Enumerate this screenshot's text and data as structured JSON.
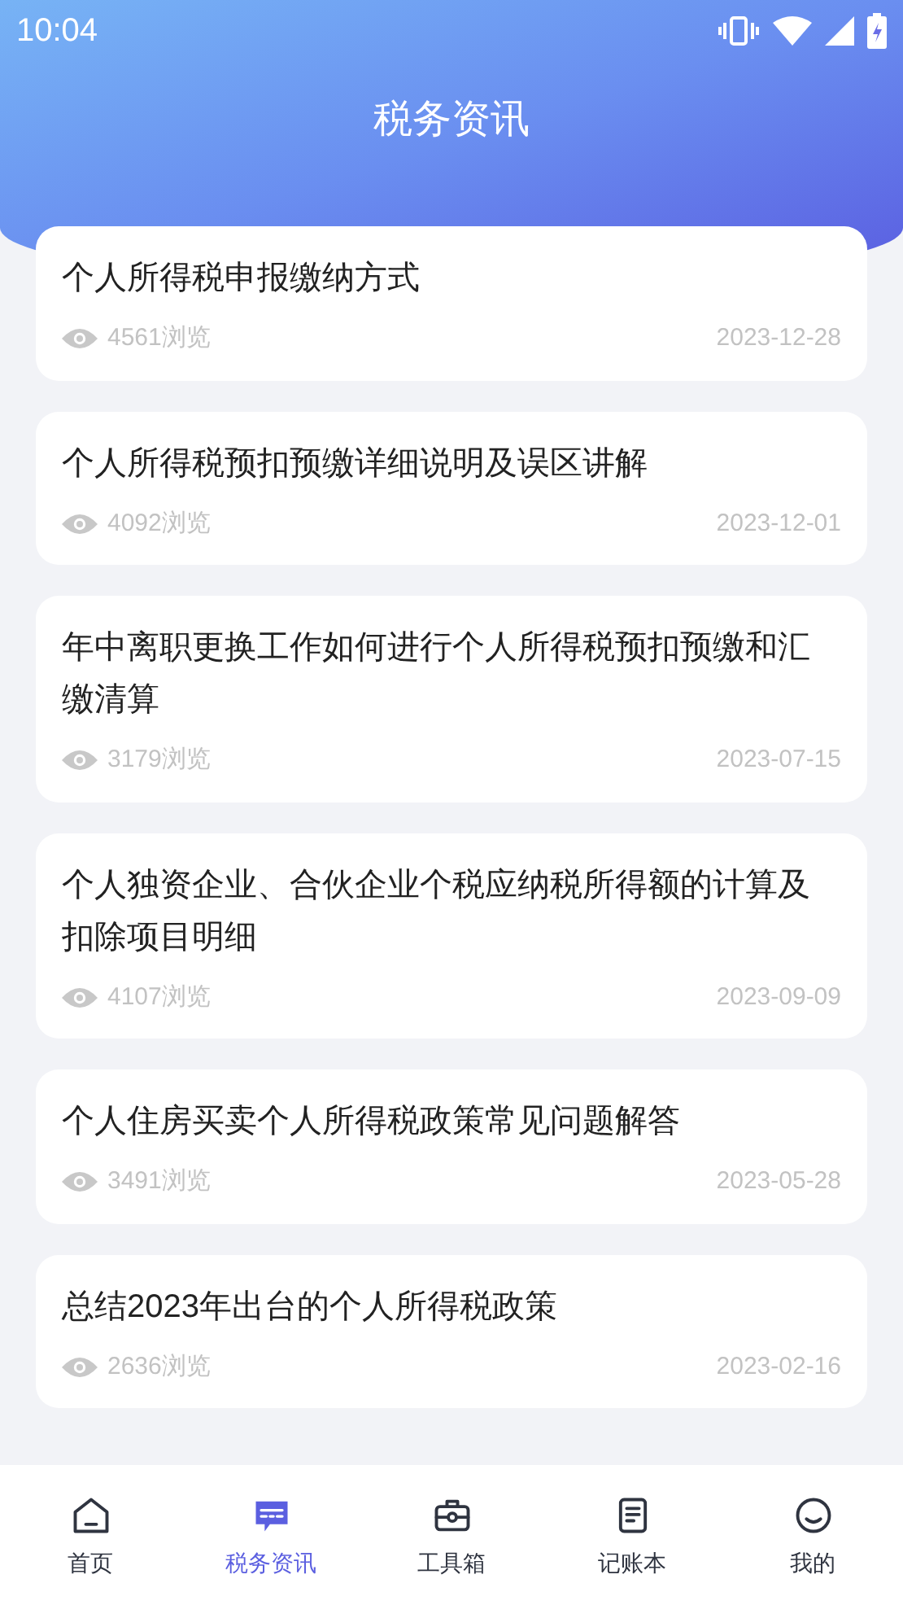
{
  "status_bar": {
    "time": "10:04"
  },
  "header": {
    "title": "税务资讯"
  },
  "articles": [
    {
      "title": "个人所得税申报缴纳方式",
      "views": "4561浏览",
      "date": "2023-12-28"
    },
    {
      "title": "个人所得税预扣预缴详细说明及误区讲解",
      "views": "4092浏览",
      "date": "2023-12-01"
    },
    {
      "title": "年中离职更换工作如何进行个人所得税预扣预缴和汇缴清算",
      "views": "3179浏览",
      "date": "2023-07-15"
    },
    {
      "title": "个人独资企业、合伙企业个税应纳税所得额的计算及扣除项目明细",
      "views": "4107浏览",
      "date": "2023-09-09"
    },
    {
      "title": "个人住房买卖个人所得税政策常见问题解答",
      "views": "3491浏览",
      "date": "2023-05-28"
    },
    {
      "title": "总结2023年出台的个人所得税政策",
      "views": "2636浏览",
      "date": "2023-02-16"
    }
  ],
  "tab_bar": [
    {
      "kind": "home",
      "label": "首页",
      "selected": false
    },
    {
      "kind": "news",
      "label": "税务资讯",
      "selected": true
    },
    {
      "kind": "tools",
      "label": "工具箱",
      "selected": false
    },
    {
      "kind": "ledger",
      "label": "记账本",
      "selected": false
    },
    {
      "kind": "profile",
      "label": "我的",
      "selected": false
    }
  ]
}
